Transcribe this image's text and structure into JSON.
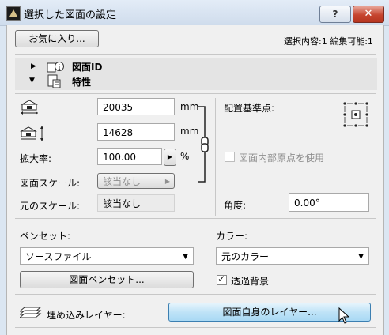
{
  "window": {
    "title": "選択した図面の設定",
    "help": "?",
    "close": "✕"
  },
  "toolbar": {
    "favorites": "お気に入り...",
    "selection_info": "選択内容:1 編集可能:1"
  },
  "sections": [
    {
      "label": "図面ID",
      "expanded": false
    },
    {
      "label": "特性",
      "expanded": true
    }
  ],
  "size": {
    "width_value": "20035",
    "height_value": "14628",
    "unit": "mm"
  },
  "scale": {
    "magnification_label": "拡大率:",
    "magnification_value": "100.00",
    "percent": "%",
    "drawing_scale_label": "図面スケール:",
    "drawing_scale_value": "該当なし",
    "original_scale_label": "元のスケール:",
    "original_scale_value": "該当なし"
  },
  "anchor": {
    "label": "配置基準点:",
    "use_internal_origin": "図面内部原点を使用",
    "use_internal_origin_checked": false
  },
  "angle": {
    "label": "角度:",
    "value": "0.00°"
  },
  "pen": {
    "label": "ペンセット:",
    "value": "ソースファイル",
    "button": "図面ペンセット..."
  },
  "color": {
    "label": "カラー:",
    "value": "元のカラー",
    "transparent_label": "透過背景",
    "transparent_checked": true
  },
  "layers": {
    "label": "埋め込みレイヤー:",
    "button": "図面自身のレイヤー..."
  },
  "colors": {
    "accent_button": "#bfe3f7",
    "close_button": "#c6452f"
  }
}
